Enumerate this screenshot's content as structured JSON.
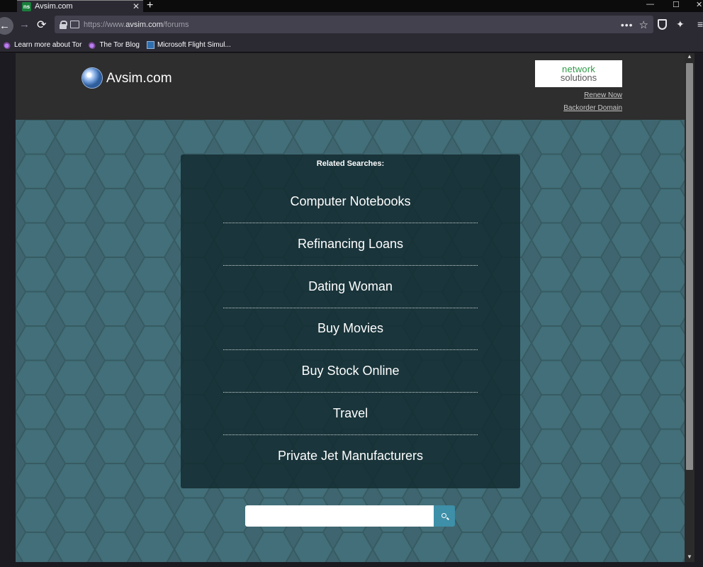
{
  "browser": {
    "tab_title": "Avsim.com",
    "tab_favicon_text": "ns",
    "new_tab_symbol": "+",
    "close_tab_symbol": "✕",
    "url_scheme_prefix": "https://www.",
    "url_host": "avsim.com",
    "url_path": "/forums",
    "bookmarks": [
      {
        "label": "Learn more about Tor",
        "icon": "tor-onion-icon"
      },
      {
        "label": "The Tor Blog",
        "icon": "tor-onion-icon"
      },
      {
        "label": "Microsoft Flight Simul...",
        "icon": "flight-sim-icon"
      }
    ]
  },
  "header": {
    "site_name": "Avsim.com",
    "sponsor_logo_line1": "network",
    "sponsor_logo_line2": "solutions",
    "renew_link": "Renew Now",
    "backorder_link": "Backorder Domain"
  },
  "related": {
    "title": "Related Searches:",
    "items": [
      "Computer Notebooks",
      "Refinancing Loans",
      "Dating Woman",
      "Buy Movies",
      "Buy Stock Online",
      "Travel",
      "Private Jet Manufacturers"
    ]
  },
  "search": {
    "value": "",
    "placeholder": ""
  },
  "colors": {
    "page_bg": "#3f6670",
    "header_bg": "#2e2e2e",
    "panel_bg": "#142d32",
    "search_button": "#3e8fa8",
    "sponsor_green": "#2f9a47"
  }
}
